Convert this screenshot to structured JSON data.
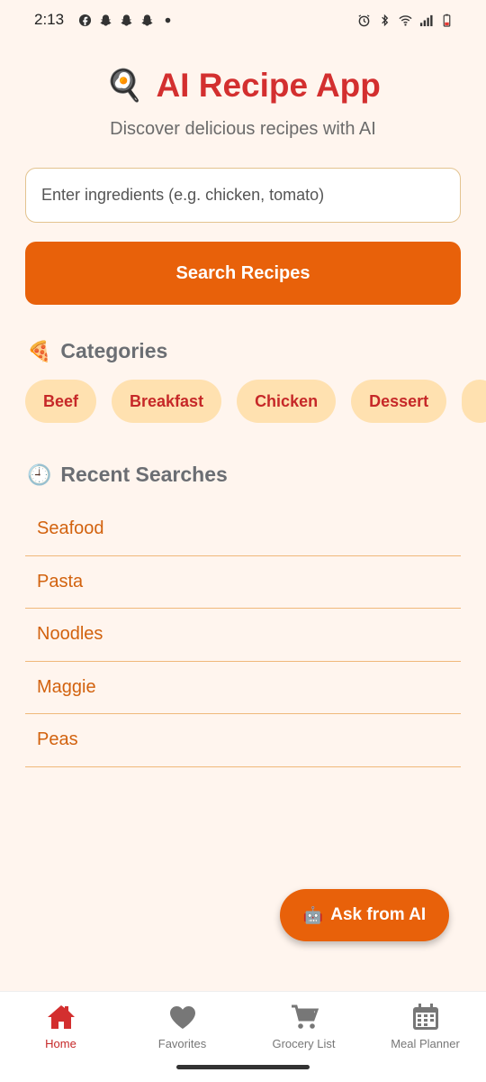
{
  "status_bar": {
    "time": "2:13",
    "icons_left": [
      "facebook-icon",
      "snapchat-icon",
      "snapchat-icon",
      "snapchat-icon",
      "dot-icon"
    ],
    "icons_right": [
      "alarm-icon",
      "bluetooth-icon",
      "wifi-icon",
      "signal-icon",
      "battery-low-icon"
    ]
  },
  "header": {
    "logo_emoji": "🍳",
    "title": "AI Recipe App",
    "subtitle": "Discover delicious recipes with AI"
  },
  "search": {
    "placeholder": "Enter ingredients (e.g. chicken, tomato)",
    "value": "",
    "button_label": "Search Recipes"
  },
  "categories": {
    "emoji": "🍕",
    "heading": "Categories",
    "items": [
      "Beef",
      "Breakfast",
      "Chicken",
      "Dessert"
    ]
  },
  "recent": {
    "emoji": "🕘",
    "heading": "Recent Searches",
    "items": [
      "Seafood",
      "Pasta",
      "Noodles",
      "Maggie",
      "Peas"
    ]
  },
  "fab": {
    "emoji": "🤖",
    "label": "Ask from AI"
  },
  "nav": {
    "items": [
      {
        "label": "Home",
        "icon": "home-icon",
        "active": true
      },
      {
        "label": "Favorites",
        "icon": "heart-icon",
        "active": false
      },
      {
        "label": "Grocery List",
        "icon": "cart-icon",
        "active": false
      },
      {
        "label": "Meal Planner",
        "icon": "calendar-icon",
        "active": false
      }
    ]
  },
  "colors": {
    "background": "#fff5ee",
    "accent": "#e8610a",
    "title_red": "#d32f2f",
    "chip_bg": "#ffe1b0"
  }
}
